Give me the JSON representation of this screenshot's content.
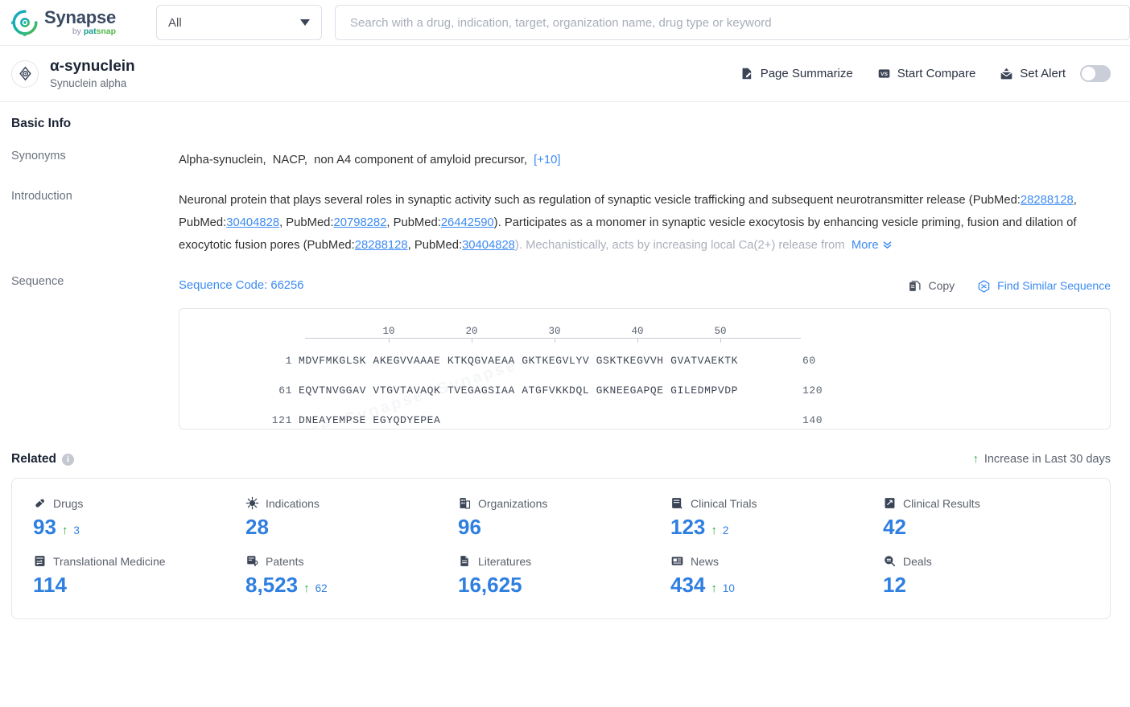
{
  "topbar": {
    "logo": {
      "name": "Synapse",
      "by": "by ",
      "pat": "pat",
      "snap": "snap"
    },
    "scope_select": {
      "value": "All"
    },
    "search": {
      "value": "",
      "placeholder": "Search with a drug, indication, target, organization name, drug type or keyword"
    }
  },
  "entity": {
    "title": "α-synuclein",
    "subtitle": "Synuclein alpha",
    "actions": [
      {
        "label": "Page Summarize",
        "icon": "page-summarize-icon"
      },
      {
        "label": "Start Compare",
        "icon": "versus-icon"
      },
      {
        "label": "Set Alert",
        "icon": "alert-mail-icon"
      }
    ],
    "alert_toggle_on": false
  },
  "basic_info": {
    "section_title": "Basic Info",
    "synonyms_label": "Synonyms",
    "synonyms": [
      "Alpha-synuclein,",
      "NACP,",
      "non A4 component of amyloid precursor,"
    ],
    "synonyms_more": "[+10]",
    "introduction_label": "Introduction",
    "introduction": {
      "p1_a": "Neuronal protein that plays several roles in synaptic activity such as regulation of synaptic vesicle trafficking and subsequent neurotransmitter release (PubMed:",
      "pm1": "28288128",
      "t1": ", PubMed:",
      "pm2": "30404828",
      "t2": ", PubMed:",
      "pm3": "20798282",
      "t3": ", PubMed:",
      "pm4": "26442590",
      "t4": "). Participates as a monomer in synaptic vesicle exocytosis by enhancing vesicle priming, fusion and dilation of exocytotic fusion pores (PubMed:",
      "pm5": "28288128",
      "t5": ", PubMed:",
      "pm6": "30404828",
      "t6": "). Mechanistically, acts by increasing local Ca(2+) release from",
      "more_label": "More"
    },
    "sequence_label": "Sequence",
    "sequence_code": "Sequence Code: 66256",
    "copy_label": "Copy",
    "find_similar_label": "Find Similar Sequence",
    "sequence": {
      "ruler_ticks": [
        10,
        20,
        30,
        40,
        50
      ],
      "lines": [
        {
          "start": "1",
          "chunks": "MDVFMKGLSK AKEGVVAAAE KTKQGVAEAA GKTKEGVLYV GSKTKEGVVH GVATVAEKTK",
          "end": "60"
        },
        {
          "start": "61",
          "chunks": "EQVTNVGGAV VTGVTAVAQK TVEGAGSIAA ATGFVKKDQL GKNEEGAPQE GILEDMPVDP",
          "end": "120"
        },
        {
          "start": "121",
          "chunks": "DNEAYEMPSE EGYQDYEPEA",
          "end": "140"
        }
      ]
    }
  },
  "related": {
    "title": "Related",
    "increase_note": "Increase in Last 30 days",
    "stats": [
      {
        "label": "Drugs",
        "icon": "pill-icon",
        "value": "93",
        "delta": "3"
      },
      {
        "label": "Indications",
        "icon": "virus-icon",
        "value": "28",
        "delta": ""
      },
      {
        "label": "Organizations",
        "icon": "building-icon",
        "value": "96",
        "delta": ""
      },
      {
        "label": "Clinical Trials",
        "icon": "clinical-trial-icon",
        "value": "123",
        "delta": "2"
      },
      {
        "label": "Clinical Results",
        "icon": "clinical-result-icon",
        "value": "42",
        "delta": ""
      },
      {
        "label": "Translational Medicine",
        "icon": "translational-medicine-icon",
        "value": "114",
        "delta": ""
      },
      {
        "label": "Patents",
        "icon": "patent-icon",
        "value": "8,523",
        "delta": "62"
      },
      {
        "label": "Literatures",
        "icon": "literature-icon",
        "value": "16,625",
        "delta": ""
      },
      {
        "label": "News",
        "icon": "news-icon",
        "value": "434",
        "delta": "10"
      },
      {
        "label": "Deals",
        "icon": "deals-icon",
        "value": "12",
        "delta": ""
      }
    ]
  },
  "colors": {
    "accent_blue": "#2f7fe0",
    "link_blue": "#3d8bf2",
    "increase_green": "#2aa83a",
    "dark_navy": "#3a4456",
    "logo_teal": "#1a9d8f",
    "logo_green": "#53b84b"
  }
}
